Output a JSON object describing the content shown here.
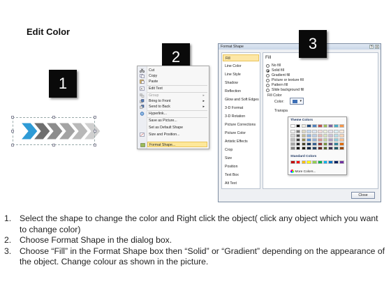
{
  "title": "Edit Color",
  "step_badges": [
    "1",
    "2",
    "3"
  ],
  "context_menu": {
    "items": [
      {
        "label": "Cut",
        "icon": "scissors-icon",
        "state": "normal"
      },
      {
        "label": "Copy",
        "icon": "copy-icon",
        "state": "normal"
      },
      {
        "label": "Paste",
        "icon": "paste-icon",
        "state": "normal"
      },
      {
        "label": "Edit Text",
        "icon": "edit-text-icon",
        "state": "normal"
      },
      {
        "label": "Group",
        "icon": "group-icon",
        "state": "disabled",
        "submenu": true
      },
      {
        "label": "Bring to Front",
        "icon": "bring-front-icon",
        "state": "normal",
        "submenu": true
      },
      {
        "label": "Send to Back",
        "icon": "send-back-icon",
        "state": "normal",
        "submenu": true
      },
      {
        "label": "Hyperlink...",
        "icon": "hyperlink-icon",
        "state": "normal"
      },
      {
        "label": "Save as Picture...",
        "icon": "",
        "state": "normal"
      },
      {
        "label": "Set as Default Shape",
        "icon": "",
        "state": "normal"
      },
      {
        "label": "Size and Position...",
        "icon": "size-icon",
        "state": "normal"
      },
      {
        "label": "Format Shape...",
        "icon": "format-shape-icon",
        "state": "highlighted"
      }
    ]
  },
  "dialog": {
    "title": "Format Shape",
    "help": "?",
    "close_x": "X",
    "categories": [
      "Fill",
      "Line Color",
      "Line Style",
      "Shadow",
      "Reflection",
      "Glow and Soft Edges",
      "3-D Format",
      "3-D Rotation",
      "Picture Corrections",
      "Picture Color",
      "Artistic Effects",
      "Crop",
      "Size",
      "Position",
      "Text Box",
      "Alt Text"
    ],
    "active_category": "Fill",
    "fill_heading": "Fill",
    "fill_options": [
      {
        "label": "No fill",
        "selected": false
      },
      {
        "label": "Solid fill",
        "selected": true
      },
      {
        "label": "Gradient fill",
        "selected": false
      },
      {
        "label": "Picture or texture fill",
        "selected": false
      },
      {
        "label": "Pattern fill",
        "selected": false
      },
      {
        "label": "Slide background fill",
        "selected": false
      }
    ],
    "fill_color_label": "Fill Color",
    "color_label": "Color:",
    "transparency_label": "Transpa",
    "close_button": "Close"
  },
  "palette": {
    "theme_heading": "Theme Colors",
    "theme_top": [
      "#ffffff",
      "#000000",
      "#eeece1",
      "#1f497d",
      "#4f81bd",
      "#c0504d",
      "#9bbb59",
      "#8064a2",
      "#4bacc6",
      "#f79646"
    ],
    "theme_rows": [
      [
        "#f2f2f2",
        "#7f7f7f",
        "#ddd9c3",
        "#c6d9f0",
        "#dbe5f1",
        "#f2dcdb",
        "#ebf1dd",
        "#e5e0ec",
        "#dbeef3",
        "#fdeada"
      ],
      [
        "#d8d8d8",
        "#595959",
        "#c4bd97",
        "#8db3e2",
        "#b8cce4",
        "#e5b9b7",
        "#d7e3bc",
        "#ccc1d9",
        "#b7dde8",
        "#fbd5b5"
      ],
      [
        "#bfbfbf",
        "#3f3f3f",
        "#938953",
        "#548dd4",
        "#95b3d7",
        "#d99694",
        "#c3d69b",
        "#b2a2c7",
        "#92cddc",
        "#fac08f"
      ],
      [
        "#a5a5a5",
        "#262626",
        "#494429",
        "#17365d",
        "#366092",
        "#953734",
        "#76923c",
        "#5f497a",
        "#31859b",
        "#e36c09"
      ],
      [
        "#7f7f7f",
        "#0c0c0c",
        "#1d1b10",
        "#0f243e",
        "#244061",
        "#632423",
        "#4f6128",
        "#3f3151",
        "#205867",
        "#974806"
      ]
    ],
    "standard_heading": "Standard Colors",
    "standard": [
      "#c00000",
      "#ff0000",
      "#ffc000",
      "#ffff00",
      "#92d050",
      "#00b050",
      "#00b0f0",
      "#0070c0",
      "#002060",
      "#7030a0"
    ],
    "more_colors": "More Colors..."
  },
  "instructions": [
    {
      "num": "1.",
      "text": "Select the shape to change the color and Right click the object( click any object which you want to change color)"
    },
    {
      "num": "2.",
      "text": "Choose Format Shape in the dialog box."
    },
    {
      "num": "3.",
      "text": "Choose “Fill” in the Format Shape box then “Solid” or “Gradient” depending on the appearance of the object. Change colour as shown in the picture."
    }
  ],
  "colors": {
    "accent_arrow": "#2e9bd6",
    "grey_arrow": "#8c8c8c",
    "highlight": "#fde89a"
  }
}
